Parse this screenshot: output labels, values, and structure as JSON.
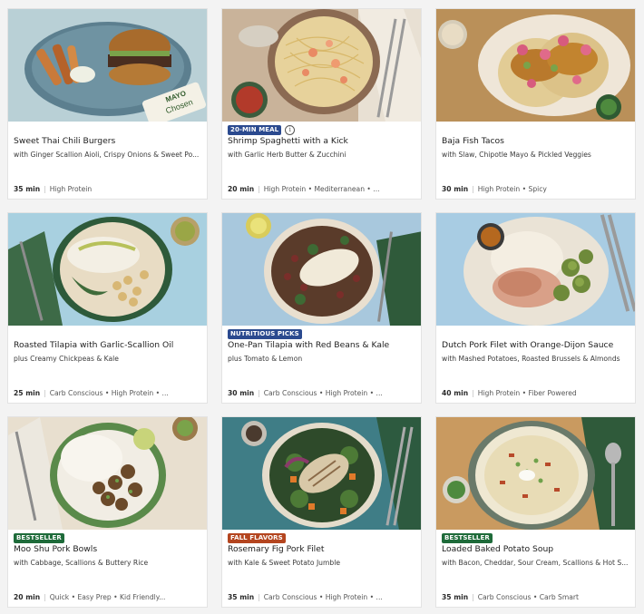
{
  "recipes": [
    {
      "title": "Sweet Thai Chili Burgers",
      "subtitle": "with Ginger Scallion Aioli, Crispy Onions & Sweet Po...",
      "time": "35 min",
      "tags": "High Protein",
      "badge": "",
      "photo_bg": "#b8cfd6"
    },
    {
      "title": "Shrimp Spaghetti with a Kick",
      "subtitle": "with Garlic Herb Butter & Zucchini",
      "time": "20 min",
      "tags": "High Protein • Mediterranean • ...",
      "badge": "20-MIN MEAL",
      "photo_bg": "#b8a38c"
    },
    {
      "title": "Baja Fish Tacos",
      "subtitle": "with Slaw, Chipotle Mayo & Pickled Veggies",
      "time": "30 min",
      "tags": "High Protein • Spicy",
      "badge": "",
      "photo_bg": "#b88e58"
    },
    {
      "title": "Roasted Tilapia with Garlic-Scallion Oil",
      "subtitle": "plus Creamy Chickpeas & Kale",
      "time": "25 min",
      "tags": "Carb Conscious • High Protein • ...",
      "badge": "",
      "photo_bg": "#a7cfdf"
    },
    {
      "title": "One-Pan Tilapia with Red Beans & Kale",
      "subtitle": "plus Tomato & Lemon",
      "time": "30 min",
      "tags": "Carb Conscious • High Protein • ...",
      "badge": "NUTRITIOUS PICKS",
      "photo_bg": "#a9c7dc"
    },
    {
      "title": "Dutch Pork Filet with Orange-Dijon Sauce",
      "subtitle": "with Mashed Potatoes, Roasted Brussels & Almonds",
      "time": "40 min",
      "tags": "High Protein • Fiber Powered",
      "badge": "",
      "photo_bg": "#a8cce3"
    },
    {
      "title": "Moo Shu Pork Bowls",
      "subtitle": "with Cabbage, Scallions & Buttery Rice",
      "time": "20 min",
      "tags": "Quick • Easy Prep • Kid Friendly...",
      "badge": "BESTSELLER",
      "photo_bg": "#e6dccd"
    },
    {
      "title": "Rosemary Fig Pork Filet",
      "subtitle": "with Kale & Sweet Potato Jumble",
      "time": "35 min",
      "tags": "Carb Conscious • High Protein • ...",
      "badge": "FALL FLAVORS",
      "photo_bg": "#3f7d86"
    },
    {
      "title": "Loaded Baked Potato Soup",
      "subtitle": "with Bacon, Cheddar, Sour Cream, Scallions & Hot S...",
      "time": "35 min",
      "tags": "Carb Conscious • Carb Smart",
      "badge": "BESTSELLER",
      "photo_bg": "#c8935a"
    }
  ],
  "badge_colors": {
    "20-MIN MEAL": "#2b4a8f",
    "NUTRITIOUS PICKS": "#2b4a8f",
    "BESTSELLER": "#1e6b3a",
    "FALL FLAVORS": "#b4451f"
  },
  "photo_text": {
    "mayo_jar_brand": "Chosen",
    "mayo_jar_label": "MAYO"
  }
}
